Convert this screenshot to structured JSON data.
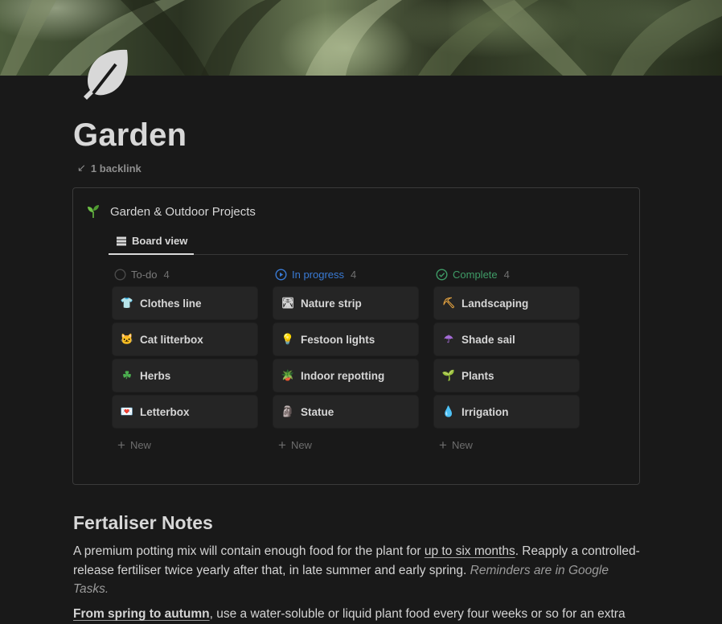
{
  "page": {
    "title": "Garden",
    "backlink": "1 backlink",
    "icon": "leaf-icon"
  },
  "database": {
    "icon": "seedling-icon",
    "title": "Garden & Outdoor Projects",
    "view_tab": "Board view",
    "columns": [
      {
        "name": "To-do",
        "count": "4",
        "color": "#7a7a7a",
        "status_icon": "circle-empty-icon",
        "cards": [
          {
            "label": "Clothes line",
            "emoji": "👕"
          },
          {
            "label": "Cat litterbox",
            "emoji": "🐱"
          },
          {
            "label": "Herbs",
            "emoji": "☘"
          },
          {
            "label": "Letterbox",
            "emoji": "💌"
          }
        ],
        "new_label": "New"
      },
      {
        "name": "In progress",
        "count": "4",
        "color": "#3a7bd5",
        "status_icon": "circle-play-icon",
        "cards": [
          {
            "label": "Nature strip",
            "emoji": "🛣"
          },
          {
            "label": "Festoon lights",
            "emoji": "💡"
          },
          {
            "label": "Indoor repotting",
            "emoji": "🪴"
          },
          {
            "label": "Statue",
            "emoji": "🗿"
          }
        ],
        "new_label": "New"
      },
      {
        "name": "Complete",
        "count": "4",
        "color": "#3f9c67",
        "status_icon": "circle-check-icon",
        "cards": [
          {
            "label": "Landscaping",
            "emoji": "⛏"
          },
          {
            "label": "Shade sail",
            "emoji": "☂"
          },
          {
            "label": "Plants",
            "emoji": "🌱"
          },
          {
            "label": "Irrigation",
            "emoji": "💧"
          }
        ],
        "new_label": "New"
      }
    ]
  },
  "notes": {
    "heading": "Fertaliser Notes",
    "p1_a": "A premium potting mix will contain enough food for the plant for ",
    "p1_link": "up to six months",
    "p1_b": ". Reapply a controlled-release fertiliser twice yearly after that, in late summer and early spring. ",
    "p1_italic": "Reminders are in Google Tasks.",
    "p2_bold": "From spring to autumn",
    "p2_rest": ", use a water-soluble or liquid plant food every four weeks or so for an extra"
  }
}
